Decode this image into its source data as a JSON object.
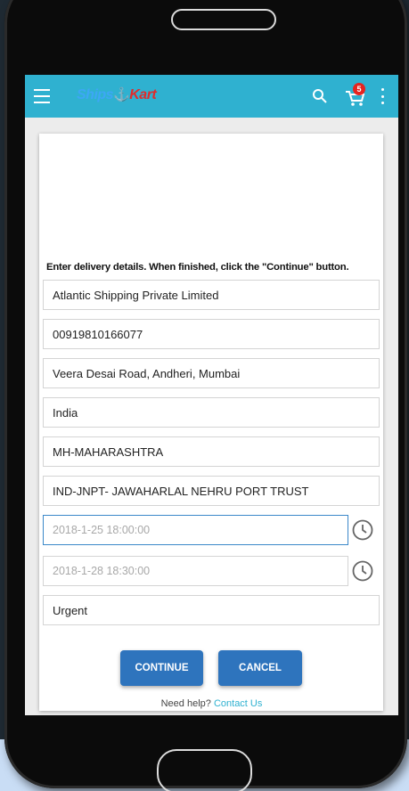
{
  "app": {
    "logo_part1": "Ships",
    "logo_part2": "Kart",
    "cart_count": "5"
  },
  "form": {
    "instructions": "Enter delivery details. When finished, click the \"Continue\" button.",
    "company": "Atlantic Shipping Private Limited",
    "phone": "00919810166077",
    "address": "Veera Desai Road, Andheri, Mumbai",
    "country": "India",
    "state": "MH-MAHARASHTRA",
    "port": "IND-JNPT- JAWAHARLAL NEHRU PORT TRUST",
    "start_datetime_placeholder": "2018-1-25 18:00:00",
    "end_datetime_placeholder": "2018-1-28 18:30:00",
    "priority": "Urgent",
    "continue_label": "CONTINUE",
    "cancel_label": "CANCEL"
  },
  "footer": {
    "help_text": "Need help?",
    "contact_label": "Contact Us"
  },
  "colors": {
    "appbar": "#2fb1d0",
    "button": "#2e74bd",
    "badge": "#e52420",
    "link": "#2fb1d0",
    "focus_border": "#3b88c9"
  }
}
